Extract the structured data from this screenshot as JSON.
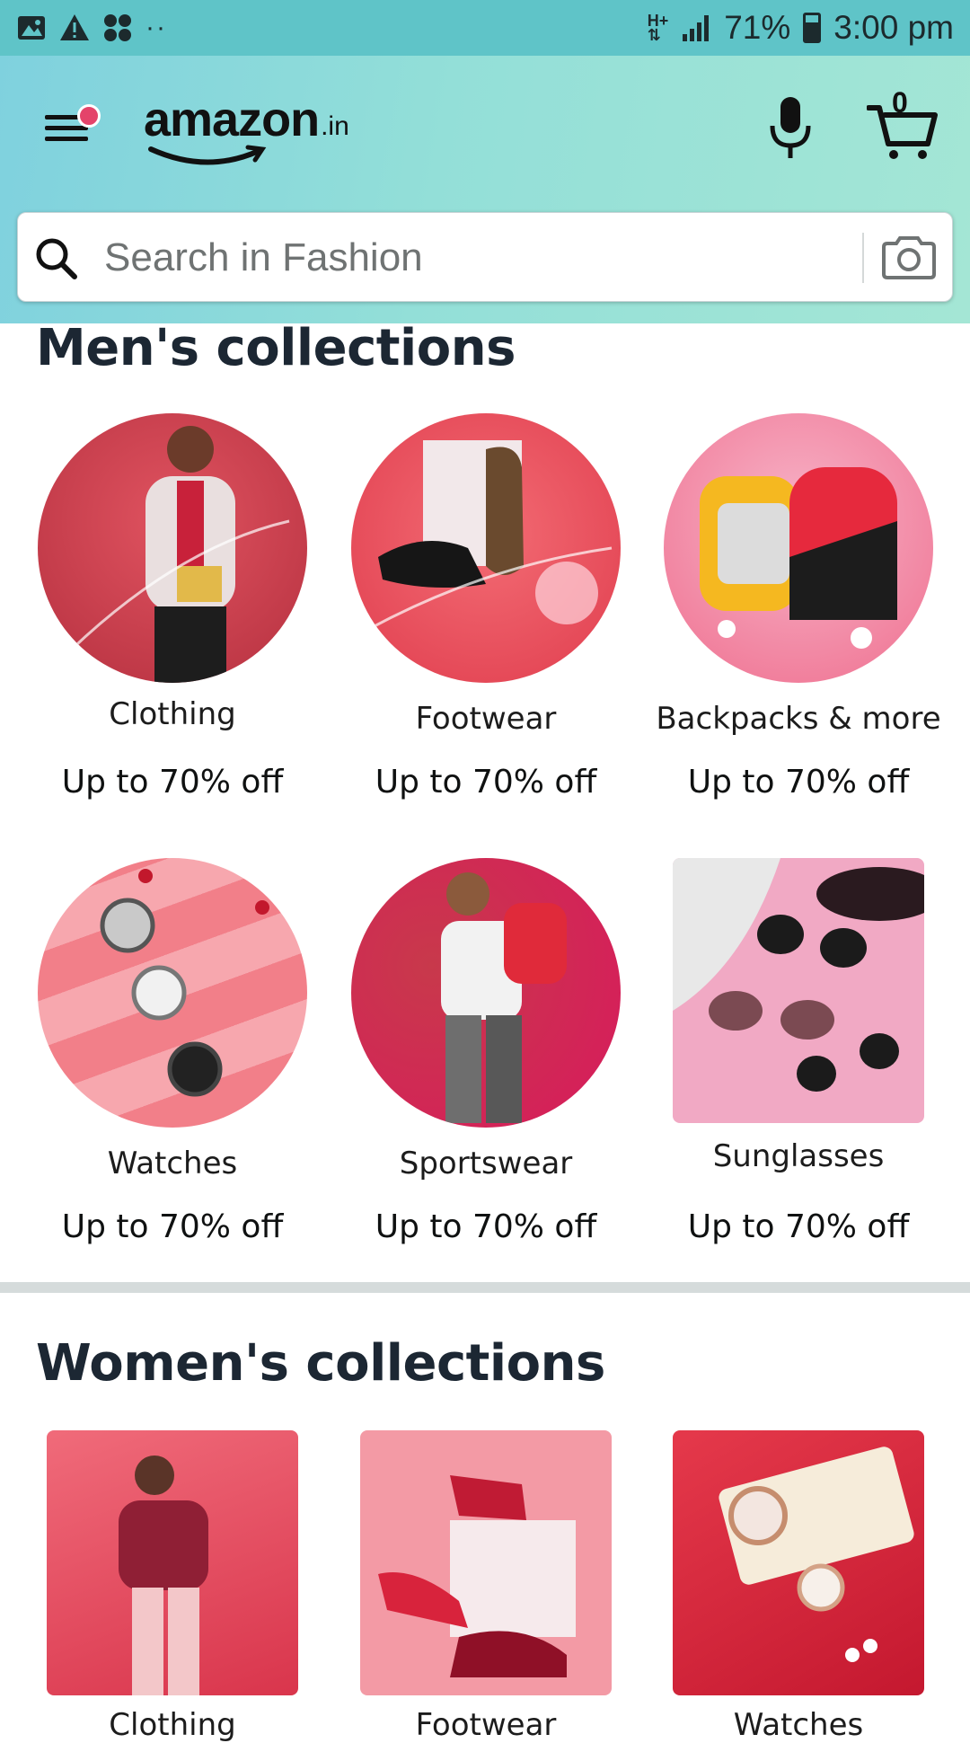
{
  "status_bar": {
    "battery": "71%",
    "time": "3:00 pm",
    "dots": "··",
    "network": "H+"
  },
  "header": {
    "logo_main": "amazon",
    "logo_suffix": ".in",
    "cart_count": "0"
  },
  "search": {
    "placeholder": "Search in Fashion"
  },
  "mens": {
    "title": "Men's collections",
    "tiles": [
      {
        "label": "Clothing",
        "offer": "Up to 70% off"
      },
      {
        "label": "Footwear",
        "offer": "Up to 70% off"
      },
      {
        "label": "Backpacks & more",
        "offer": "Up to 70% off"
      },
      {
        "label": "Watches",
        "offer": "Up to 70% off"
      },
      {
        "label": "Sportswear",
        "offer": "Up to 70% off"
      },
      {
        "label": "Sunglasses",
        "offer": "Up to 70% off"
      }
    ]
  },
  "womens": {
    "title": "Women's collections",
    "tiles": [
      {
        "label": "Clothing"
      },
      {
        "label": "Footwear"
      },
      {
        "label": "Watches"
      }
    ]
  },
  "colors": {
    "status_bar": "#5fc4c8",
    "header_start": "#7fd1de",
    "header_end": "#a4e6d5",
    "notification_dot": "#e4436a",
    "tile_red": "#d9424f",
    "tile_pink": "#f4a6b4"
  },
  "icons": [
    "gallery-icon",
    "warning-icon",
    "apps-icon",
    "network-icon",
    "signal-icon",
    "battery-icon",
    "menu-icon",
    "mic-icon",
    "cart-icon",
    "search-icon",
    "camera-icon"
  ]
}
